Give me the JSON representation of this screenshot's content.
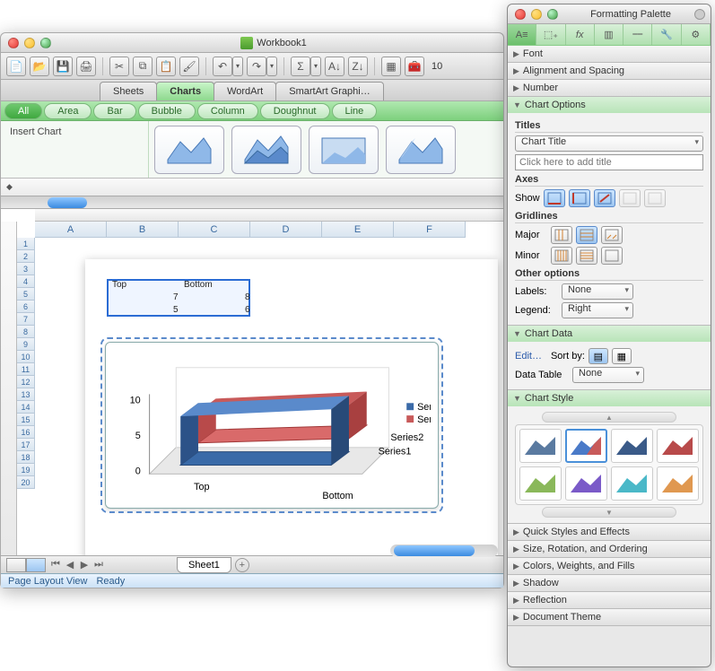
{
  "workbook": {
    "title": "Workbook1",
    "ribbon_tabs": [
      "Sheets",
      "Charts",
      "WordArt",
      "SmartArt Graphi…"
    ],
    "active_ribbon_tab": 1,
    "categories": [
      "All",
      "Area",
      "Bar",
      "Bubble",
      "Column",
      "Doughnut",
      "Line"
    ],
    "active_category": 0,
    "ribbon_label": "Insert Chart",
    "sheet_tab": "Sheet1",
    "status_view": "Page Layout View",
    "status_ready": "Ready",
    "zoom_value": "10",
    "columns": [
      "A",
      "B",
      "C",
      "D",
      "E",
      "F"
    ],
    "row_count": 20
  },
  "spreadsheet": {
    "cells": {
      "B1": "Top",
      "C1": "Bottom",
      "B2": "7",
      "C2": "8",
      "B3": "5",
      "C3": "6"
    }
  },
  "chart_data": {
    "type": "area",
    "categories": [
      "Top",
      "Bottom"
    ],
    "series": [
      {
        "name": "Series1",
        "values": [
          7,
          8
        ]
      },
      {
        "name": "Series2",
        "values": [
          5,
          6
        ]
      }
    ],
    "ylim": [
      0,
      10
    ],
    "yticks": [
      0,
      5,
      10
    ],
    "legend_position": "right",
    "xlabel": "",
    "ylabel": "",
    "title": "",
    "view_3d": true
  },
  "palette": {
    "title": "Formatting Palette",
    "sections_collapsed": [
      "Font",
      "Alignment and Spacing",
      "Number"
    ],
    "chart_options": {
      "title": "Chart Options",
      "titles_label": "Titles",
      "title_select": "Chart Title",
      "title_placeholder": "Click here to add title",
      "axes_label": "Axes",
      "show_label": "Show",
      "gridlines_label": "Gridlines",
      "major_label": "Major",
      "minor_label": "Minor",
      "other_label": "Other options",
      "labels_label": "Labels:",
      "labels_value": "None",
      "legend_label": "Legend:",
      "legend_value": "Right"
    },
    "chart_data_section": {
      "title": "Chart Data",
      "edit": "Edit…",
      "sortby": "Sort by:",
      "datatable_label": "Data Table",
      "datatable_value": "None"
    },
    "chart_style": {
      "title": "Chart Style"
    },
    "sections_collapsed_bottom": [
      "Quick Styles and Effects",
      "Size, Rotation, and Ordering",
      "Colors, Weights, and Fills",
      "Shadow",
      "Reflection",
      "Document Theme"
    ]
  }
}
